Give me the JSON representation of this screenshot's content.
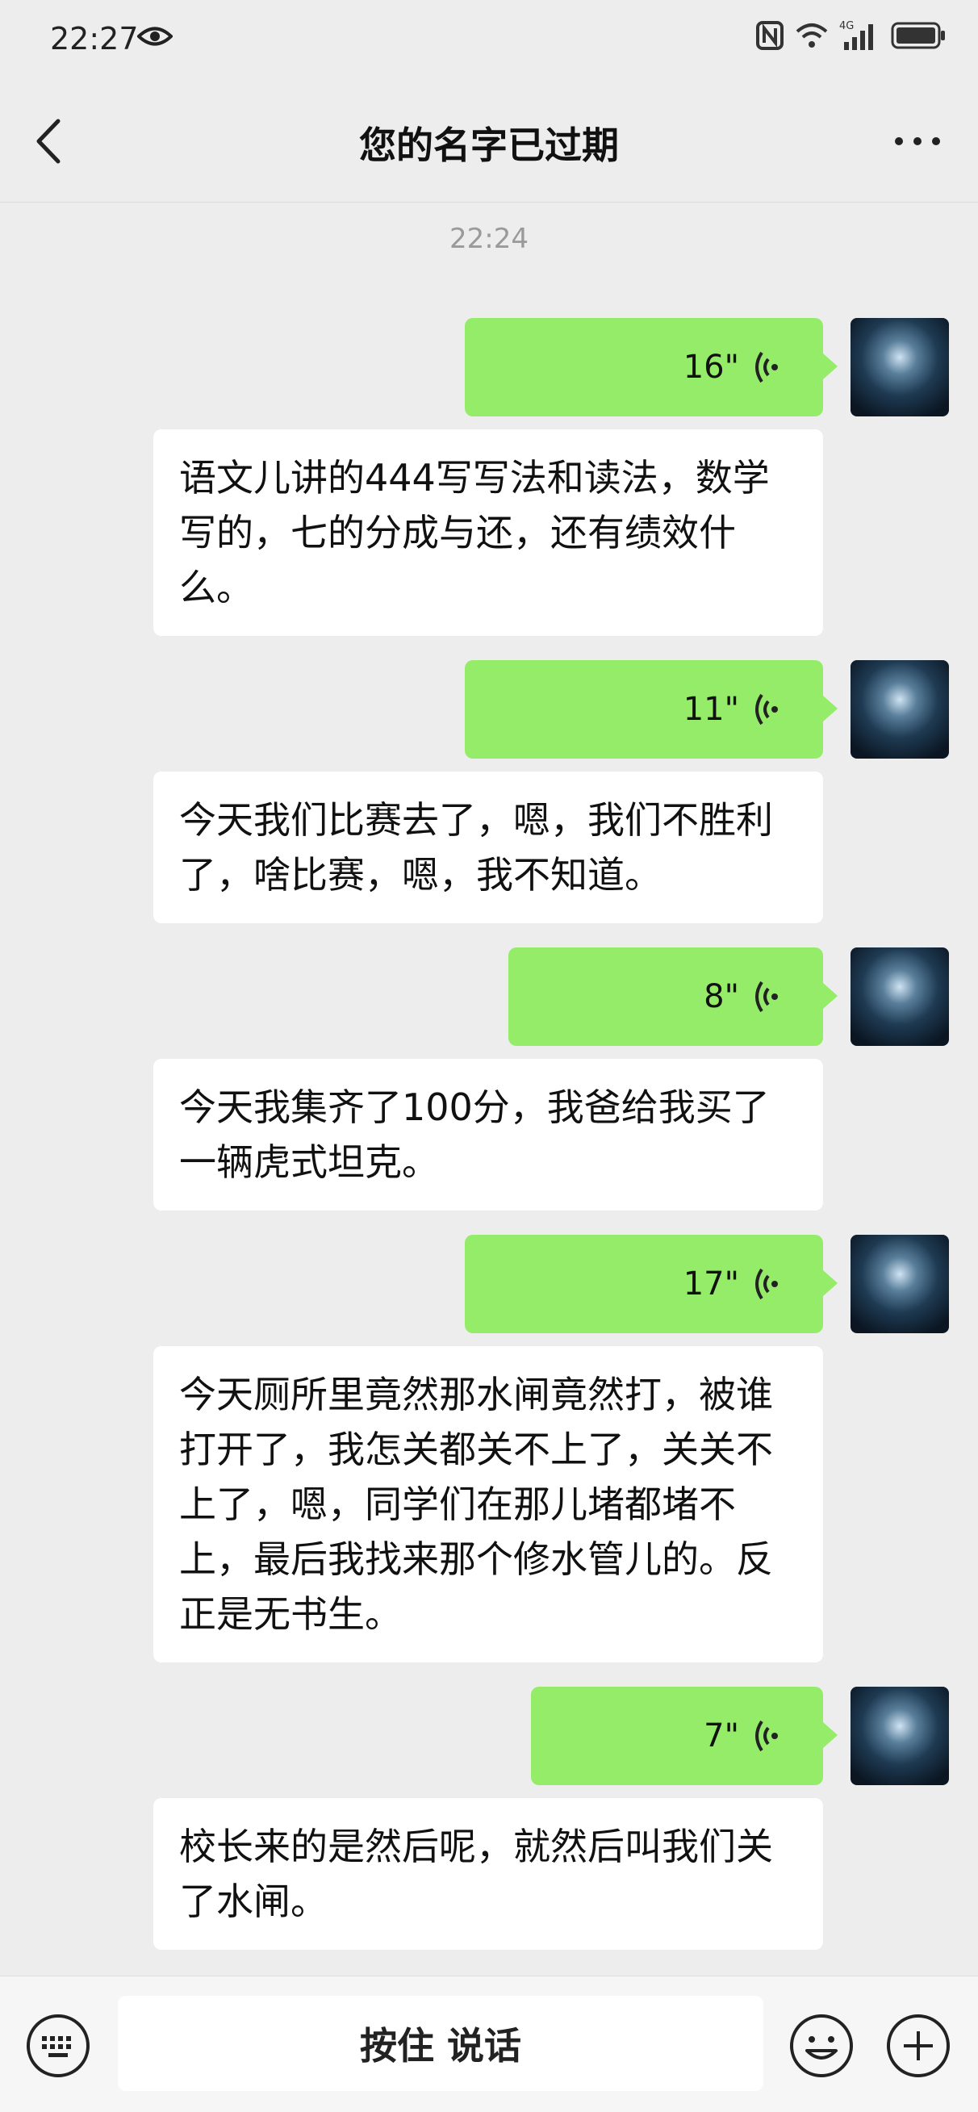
{
  "status_bar": {
    "time": "22:27",
    "network": "4G"
  },
  "header": {
    "title": "您的名字已过期"
  },
  "timestamp": "22:24",
  "messages": [
    {
      "voice_duration": "16\"",
      "text": "语文儿讲的444写写法和读法，数学写的，七的分成与还，还有绩效什么。"
    },
    {
      "voice_duration": "11\"",
      "text": "今天我们比赛去了，嗯，我们不胜利了，啥比赛，嗯，我不知道。"
    },
    {
      "voice_duration": "8\"",
      "text": "今天我集齐了100分，我爸给我买了一辆虎式坦克。"
    },
    {
      "voice_duration": "17\"",
      "text": "今天厕所里竟然那水闸竟然打，被谁打开了，我怎关都关不上了，关关不上了，嗯，同学们在那儿堵都堵不上，最后我找来那个修水管儿的。反正是无书生。"
    },
    {
      "voice_duration": "7\"",
      "text": "校长来的是然后呢，就然后叫我们关了水闸。"
    }
  ],
  "input_bar": {
    "talk_label": "按住 说话"
  },
  "colors": {
    "voice_bubble": "#95ec69",
    "text_bubble": "#ffffff",
    "background": "#ededed"
  }
}
